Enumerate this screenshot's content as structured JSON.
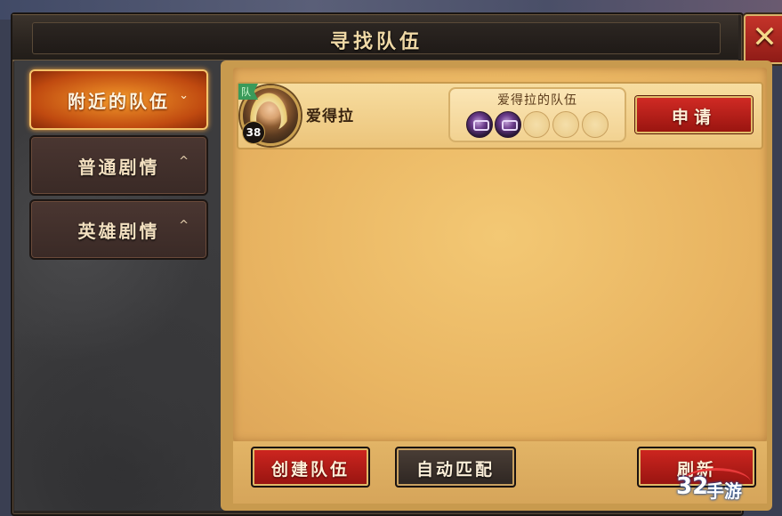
{
  "window": {
    "title": "寻找队伍",
    "close_icon": "close-x-icon"
  },
  "sidebar": {
    "tabs": [
      {
        "label": "附近的队伍",
        "active": true,
        "chevron": "⌄"
      },
      {
        "label": "普通剧情",
        "active": false,
        "chevron": "^"
      },
      {
        "label": "英雄剧情",
        "active": false,
        "chevron": "^"
      }
    ]
  },
  "team_list": [
    {
      "leader_name": "爱得拉",
      "leader_level": "38",
      "leader_badge": "队",
      "team_name": "爱得拉的队伍",
      "members_filled": 2,
      "slots_total": 5,
      "apply_label": "申请"
    }
  ],
  "actions": {
    "create_label": "创建队伍",
    "auto_match_label": "自动匹配",
    "refresh_label": "刷新"
  },
  "watermark": {
    "number": "32",
    "text": "手游"
  },
  "colors": {
    "accent_red": "#c0221c",
    "tab_active": "#e0701a",
    "parchment": "#ecbd6c",
    "title_gold": "#f0d9a6"
  }
}
